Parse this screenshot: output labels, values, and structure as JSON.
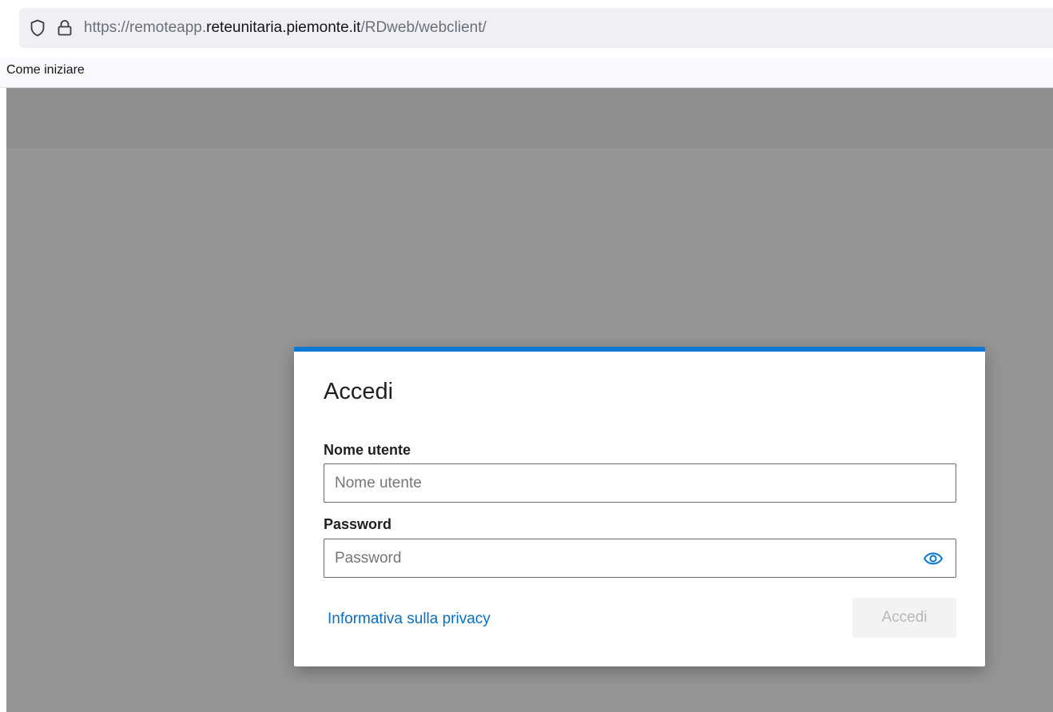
{
  "browser": {
    "url_prefix": "https://remoteapp.",
    "url_domain": "reteunitaria.piemonte.it",
    "url_path": "/RDweb/webclient/",
    "icons": [
      "shield-icon",
      "lock-icon"
    ]
  },
  "bookmarks": {
    "items": [
      {
        "label": "Come iniziare"
      }
    ]
  },
  "dialog": {
    "title": "Accedi",
    "username_label": "Nome utente",
    "username_placeholder": "Nome utente",
    "username_value": "",
    "password_label": "Password",
    "password_placeholder": "Password",
    "password_value": "",
    "show_password_icon": "eye-icon",
    "privacy_link": "Informativa sulla privacy",
    "submit_label": "Accedi",
    "submit_disabled": true,
    "accent_color": "#0a78d4",
    "link_color": "#0a6fc2"
  }
}
